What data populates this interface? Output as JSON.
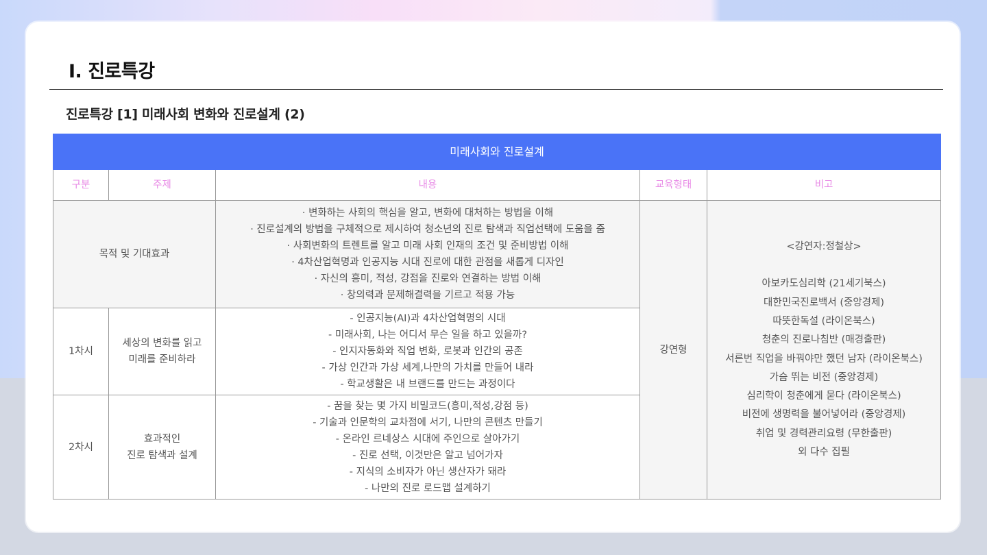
{
  "page": {
    "title": "I. 진로특강",
    "subtitle": "진로특강 [1] 미래사회 변화와 진로설계 (2)"
  },
  "table": {
    "banner": "미래사회와 진로설계",
    "headers": {
      "category": "구분",
      "topic": "주제",
      "content": "내용",
      "format": "교육형태",
      "remarks": "비고"
    },
    "purpose": {
      "label": "목적 및 기대효과",
      "items": [
        "· 변화하는 사회의 핵심을 알고, 변화에 대처하는 방법을 이해",
        "· 진로설계의 방법을 구체적으로 제시하여 청소년의 진로 탐색과 직업선택에 도움을 줌",
        "· 사회변화의 트렌트를 알고 미래 사회 인재의 조건 및 준비방법 이해",
        "· 4차산업혁명과 인공지능 시대 진로에 대한 관점을 새롭게 디자인",
        "· 자신의 흥미, 적성, 강점을 진로와 연결하는 방법 이해",
        "· 창의력과 문제해결력을 기르고 적용 가능"
      ]
    },
    "sessions": [
      {
        "label": "1차시",
        "topic_lines": [
          "세상의 변화를 읽고",
          "미래를 준비하라"
        ],
        "items": [
          "- 인공지능(AI)과 4차산업혁명의 시대",
          "- 미래사회, 나는 어디서 무슨 일을 하고 있을까?",
          "- 인지자동화와 직업 변화, 로봇과 인간의 공존",
          "- 가상 인간과 가상 세계,나만의 가치를 만들어 내라",
          "- 학교생활은 내 브랜드를 만드는 과정이다"
        ]
      },
      {
        "label": "2차시",
        "topic_lines": [
          "효과적인",
          "진로 탐색과 설계"
        ],
        "items": [
          "- 꿈을 찾는 몇 가지 비밀코드(흥미,적성,강점 등)",
          "- 기술과 인문학의 교차점에 서기, 나만의 콘텐츠 만들기",
          "- 온라인 르네상스 시대에 주인으로 살아가기",
          "- 진로 선택, 이것만은 알고 넘어가자",
          "- 지식의 소비자가 아닌 생산자가 돼라",
          "- 나만의 진로 로드맵 설계하기"
        ]
      }
    ],
    "format": "강연형",
    "remarks": {
      "speaker": "<강연자:정철상>",
      "books": [
        "아보카도심리학 (21세기북스)",
        "대한민국진로백서 (중앙경제)",
        "따뜻한독설 (라이온북스)",
        "청춘의 진로나침반 (매경출판)",
        "서른번 직업을 바꿔야만 했던 남자 (라이온북스)",
        "가슴 뛰는 비전 (중앙경제)",
        "심리학이 청춘에게 묻다 (라이온북스)",
        "비전에 생명력을 불어넣어라 (중앙경제)",
        "취업 및 경력관리요령 (무한출판)",
        "외 다수 집필"
      ]
    }
  },
  "colors": {
    "banner": "#4a73f7",
    "header_text": "#e88be6"
  }
}
